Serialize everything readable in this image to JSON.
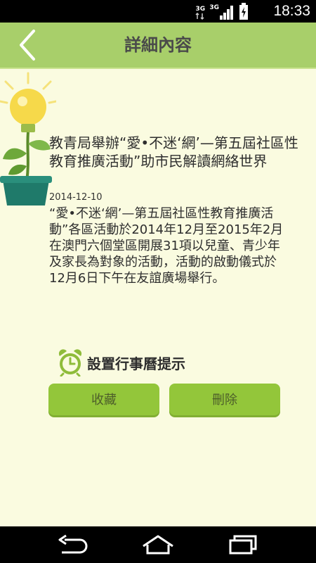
{
  "status_bar": {
    "network_a": "3G",
    "network_b": "3G",
    "time": "18:33"
  },
  "header": {
    "title": "詳細內容"
  },
  "article": {
    "title": "教青局舉辦“愛•不迷‘網’—第五屆社區性教育推廣活動”助市民解讀網絡世界",
    "date": "2014-12-10",
    "body": "“愛•不迷‘網’—第五屆社區性教育推廣活動”各區活動於2014年12月至2015年2月在澳門六個堂區開展31項以兒童、青少年及家長為對象的活動，活動的啟動儀式於12月6日下午在友誼廣場舉行。"
  },
  "reminder": {
    "label": "設置行事曆提示"
  },
  "actions": {
    "favorite_label": "收藏",
    "delete_label": "刪除"
  },
  "colors": {
    "header": "#a8cf6a",
    "background": "#fafbe0",
    "button": "#93c63a",
    "clock_icon": "#8fbc3a"
  },
  "icons": {
    "back": "chevron-left-icon",
    "reminder": "alarm-clock-icon",
    "nav_back": "back-arrow-icon",
    "nav_home": "home-icon",
    "nav_recent": "recent-apps-icon"
  }
}
